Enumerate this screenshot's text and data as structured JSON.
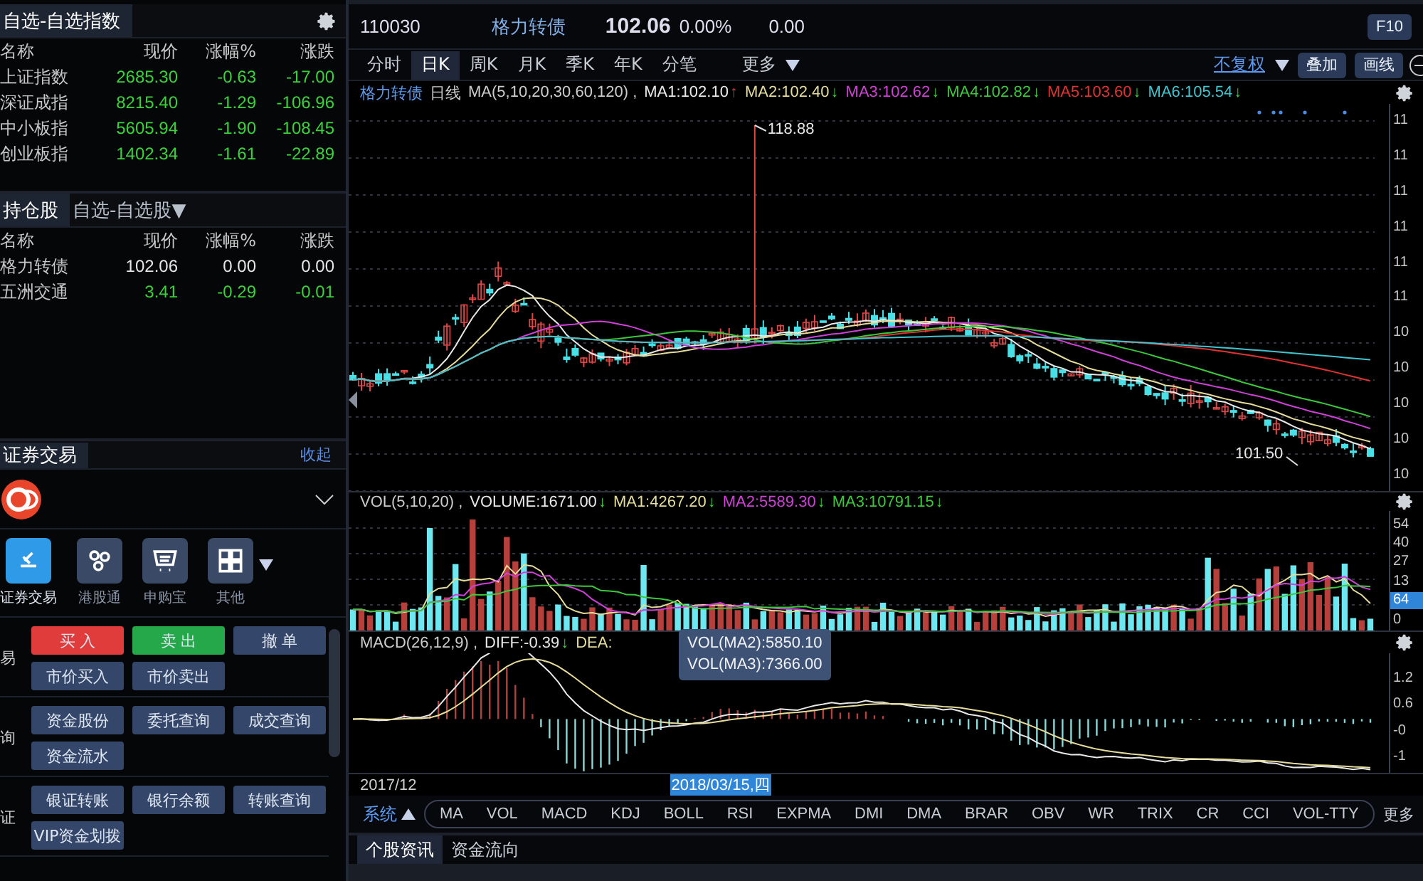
{
  "watchlist": {
    "title": "自选-自选指数",
    "columns": [
      "名称",
      "现价",
      "涨幅%",
      "涨跌"
    ],
    "rows": [
      {
        "name": "上证指数",
        "price": "2685.30",
        "pct": "-0.63",
        "change": "-17.00",
        "color": "#3ad23a"
      },
      {
        "name": "深证成指",
        "price": "8215.40",
        "pct": "-1.29",
        "change": "-106.96",
        "color": "#3ad23a"
      },
      {
        "name": "中小板指",
        "price": "5605.94",
        "pct": "-1.90",
        "change": "-108.45",
        "color": "#3ad23a"
      },
      {
        "name": "创业板指",
        "price": "1402.34",
        "pct": "-1.61",
        "change": "-22.89",
        "color": "#3ad23a"
      }
    ]
  },
  "holdings": {
    "tabs": [
      {
        "label": "持仓股",
        "selected": true
      },
      {
        "label": "自选-自选股▼",
        "selected": false
      }
    ],
    "columns": [
      "名称",
      "现价",
      "涨幅%",
      "涨跌"
    ],
    "rows": [
      {
        "name": "格力转债",
        "price": "102.06",
        "pct": "0.00",
        "change": "0.00",
        "color": "#e6e6e6"
      },
      {
        "name": "五洲交通",
        "price": "3.41",
        "pct": "-0.29",
        "change": "-0.01",
        "color": "#3ad23a"
      }
    ]
  },
  "trading": {
    "title": "证券交易",
    "collapse": "收起",
    "apps": [
      {
        "label": "证券交易",
        "selected": true
      },
      {
        "label": "港股通",
        "selected": false
      },
      {
        "label": "申购宝",
        "selected": false
      },
      {
        "label": "其他",
        "selected": false
      }
    ],
    "groups": [
      {
        "label": "易",
        "buttons": [
          {
            "label": "买 入",
            "kind": "buy"
          },
          {
            "label": "卖 出",
            "kind": "sell"
          },
          {
            "label": "撤 单",
            "kind": "normal"
          },
          {
            "label": "市价买入",
            "kind": "normal"
          },
          {
            "label": "市价卖出",
            "kind": "normal"
          }
        ]
      },
      {
        "label": "询",
        "buttons": [
          {
            "label": "资金股份",
            "kind": "normal"
          },
          {
            "label": "委托查询",
            "kind": "normal"
          },
          {
            "label": "成交查询",
            "kind": "normal"
          },
          {
            "label": "资金流水",
            "kind": "normal"
          }
        ]
      },
      {
        "label": "证",
        "buttons": [
          {
            "label": "银证转账",
            "kind": "normal"
          },
          {
            "label": "银行余额",
            "kind": "normal"
          },
          {
            "label": "转账查询",
            "kind": "normal"
          },
          {
            "label": "VIP资金划拨",
            "kind": "normal"
          }
        ]
      }
    ]
  },
  "quote": {
    "code": "110030",
    "name": "格力转债",
    "price": "102.06",
    "pct": "0.00%",
    "change": "0.00",
    "f10": "F10"
  },
  "periods": [
    {
      "label": "分时",
      "selected": false
    },
    {
      "label": "日K",
      "selected": true
    },
    {
      "label": "周K",
      "selected": false
    },
    {
      "label": "月K",
      "selected": false
    },
    {
      "label": "季K",
      "selected": false
    },
    {
      "label": "年K",
      "selected": false
    },
    {
      "label": "分笔",
      "selected": false
    }
  ],
  "more": "更多",
  "adjust": "不复权",
  "overlay": "叠加",
  "draw": "画线",
  "ma_legend": {
    "name": "格力转债",
    "period": "日线",
    "params": "MA(5,10,20,30,60,120) ,",
    "items": [
      {
        "text": "MA1:102.10",
        "color": "#e8e8e8",
        "arrow": "↑",
        "rising": true
      },
      {
        "text": "MA2:102.40",
        "color": "#e6dc9a",
        "arrow": "↓",
        "rising": false
      },
      {
        "text": "MA3:102.62",
        "color": "#d040d8",
        "arrow": "↓",
        "rising": false
      },
      {
        "text": "MA4:102.82",
        "color": "#3cc83c",
        "arrow": "↓",
        "rising": false
      },
      {
        "text": "MA5:103.60",
        "color": "#e03232",
        "arrow": "↓",
        "rising": false
      },
      {
        "text": "MA6:105.54",
        "color": "#40c4d0",
        "arrow": "↓",
        "rising": false
      }
    ]
  },
  "price_axis": [
    "11",
    "11",
    "11",
    "11",
    "11",
    "11",
    "10",
    "10",
    "10",
    "10",
    "10"
  ],
  "high_label": "118.88",
  "low_label": "101.50",
  "volume": {
    "params": "VOL(5,10,20) ,",
    "items": [
      {
        "text": "VOLUME:1671.00",
        "color": "#e8e8e8",
        "arrow": "↓",
        "rising": false
      },
      {
        "text": "MA1:4267.20",
        "color": "#e6dc9a",
        "arrow": "↓",
        "rising": false
      },
      {
        "text": "MA2:5589.30",
        "color": "#d040d8",
        "arrow": "↓",
        "rising": false
      },
      {
        "text": "MA3:10791.15",
        "color": "#3cc83c",
        "arrow": "↓",
        "rising": false
      }
    ],
    "axis": [
      "54",
      "40",
      "27",
      "13"
    ],
    "badge": "64",
    "axis_zero": "0"
  },
  "macd": {
    "params": "MACD(26,12,9) ,",
    "items": [
      {
        "text": "DIFF:-0.39",
        "color": "#e8e8e8",
        "arrow": "↓",
        "rising": false
      },
      {
        "text": "DEA:",
        "color": "#e6dc9a"
      }
    ],
    "axis": [
      "1.2",
      "0.6",
      "-0",
      "-1"
    ]
  },
  "tooltip": [
    "VOL(MA2):5850.10",
    "VOL(MA3):7366.00"
  ],
  "dates": {
    "start": "2017/12",
    "cursor": "2018/03/15,四"
  },
  "indicators": {
    "system": "系统",
    "items": [
      "MA",
      "VOL",
      "MACD",
      "KDJ",
      "BOLL",
      "RSI",
      "EXPMA",
      "DMI",
      "DMA",
      "BRAR",
      "OBV",
      "WR",
      "TRIX",
      "CR",
      "CCI",
      "VOL-TTY"
    ],
    "more": "更多"
  },
  "bottom_tabs": [
    {
      "label": "个股资讯",
      "selected": true
    },
    {
      "label": "资金流向",
      "selected": false
    }
  ]
}
